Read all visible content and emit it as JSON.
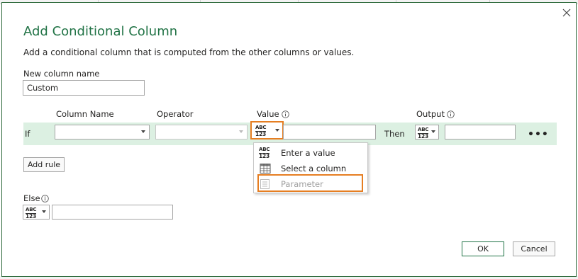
{
  "dialog": {
    "title": "Add Conditional Column",
    "subtitle": "Add a conditional column that is computed from the other columns or values.",
    "close_icon": "close-icon"
  },
  "new_column": {
    "label": "New column name",
    "value": "Custom"
  },
  "headers": {
    "column_name": "Column Name",
    "operator": "Operator",
    "value": "Value",
    "output": "Output"
  },
  "rule": {
    "if_label": "If",
    "then_label": "Then",
    "more_label": "•••",
    "column_name_value": "",
    "operator_value": "",
    "value_input": "",
    "output_input": ""
  },
  "type_glyph": {
    "top": "ABC",
    "bottom": "123"
  },
  "value_menu": {
    "items": [
      {
        "label": "Enter a value",
        "icon": "abc-123-icon",
        "enabled": true
      },
      {
        "label": "Select a column",
        "icon": "table-column-icon",
        "enabled": true
      },
      {
        "label": "Parameter",
        "icon": "parameter-icon",
        "enabled": false
      }
    ]
  },
  "add_rule_label": "Add rule",
  "else": {
    "label": "Else",
    "value": ""
  },
  "footer": {
    "ok_label": "OK",
    "cancel_label": "Cancel"
  },
  "colors": {
    "accent": "#217346",
    "row_highlight": "#dcf0e2",
    "callout": "#e67e22"
  }
}
